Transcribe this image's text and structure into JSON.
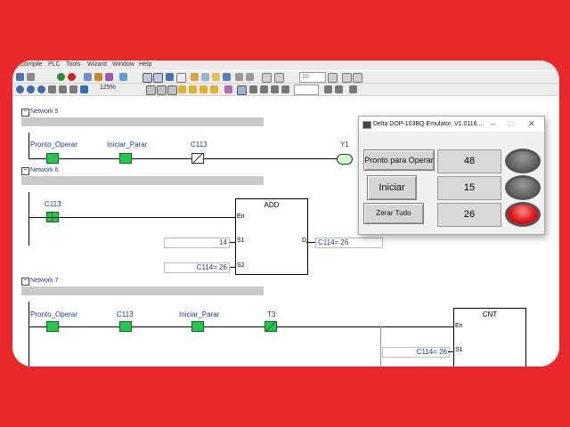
{
  "menu": [
    "Compile",
    "PLC",
    "Tools",
    "Wizard",
    "Window",
    "Help"
  ],
  "toolbar": {
    "zoom": "125%",
    "step_value": "10"
  },
  "networks": [
    {
      "label": "Network 5"
    },
    {
      "label": "Network 6"
    },
    {
      "label": "Network 7"
    }
  ],
  "net5": {
    "contact1": "Pronto_Operar",
    "contact2": "Iniciar_Parar",
    "contact3": "C113",
    "coil": "Y1"
  },
  "net6": {
    "contact1": "C113",
    "block": "ADD",
    "pin_en": "En",
    "pin_s1": "S1",
    "pin_s2": "S2",
    "pin_d": "D",
    "s1_value": "14",
    "s2_value": "C114= 26",
    "d_value": "C114= 26"
  },
  "net7": {
    "contact1": "Pronto_Operar",
    "contact2": "C113",
    "contact3": "Iniciar_Parar",
    "contact4": "T3",
    "block": "CNT",
    "pin_en": "En",
    "pin_s1": "S1",
    "s1_value": "C114= 26"
  },
  "emulator": {
    "title": "Delta DOP-103BQ Emulator, V1.0116...",
    "btn_ready": "Pronto para Operar",
    "btn_start": "Iniciar",
    "btn_reset": "Zerar Tudo",
    "val1": "48",
    "val2": "15",
    "val3": "26",
    "lamp_colors": {
      "off": "#6a6a6a",
      "on": "#e01818"
    }
  }
}
